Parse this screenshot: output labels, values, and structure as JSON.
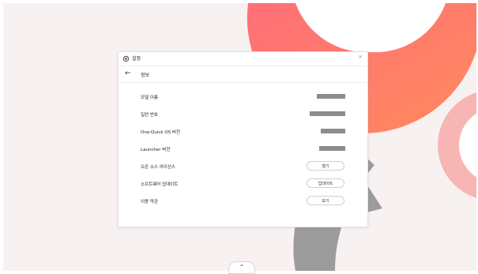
{
  "dialog": {
    "title": "설정",
    "header": "정보",
    "close_glyph": "×",
    "back_glyph": "←"
  },
  "rows": {
    "model_name": {
      "label": "모델 이름"
    },
    "serial": {
      "label": "일련 번호"
    },
    "oneqos": {
      "label": "One:Quick OS 버전"
    },
    "launcher": {
      "label": "Launcher 버전"
    },
    "opensource": {
      "label": "오픈 소스 라이선스",
      "button": "열기"
    },
    "software": {
      "label": "소프트웨어 업데이트",
      "button": "업데이트"
    },
    "terms": {
      "label": "이용 약관",
      "button": "보기"
    }
  },
  "bottom_handle": {
    "glyph": "⌃"
  },
  "colors": {
    "background": "#f8f1f1",
    "accent_coral": "#ff7b6e",
    "accent_pink": "#f7b5b4",
    "gray_shape": "#9c9c9c",
    "redacted_bar": "#8c8c8c"
  }
}
